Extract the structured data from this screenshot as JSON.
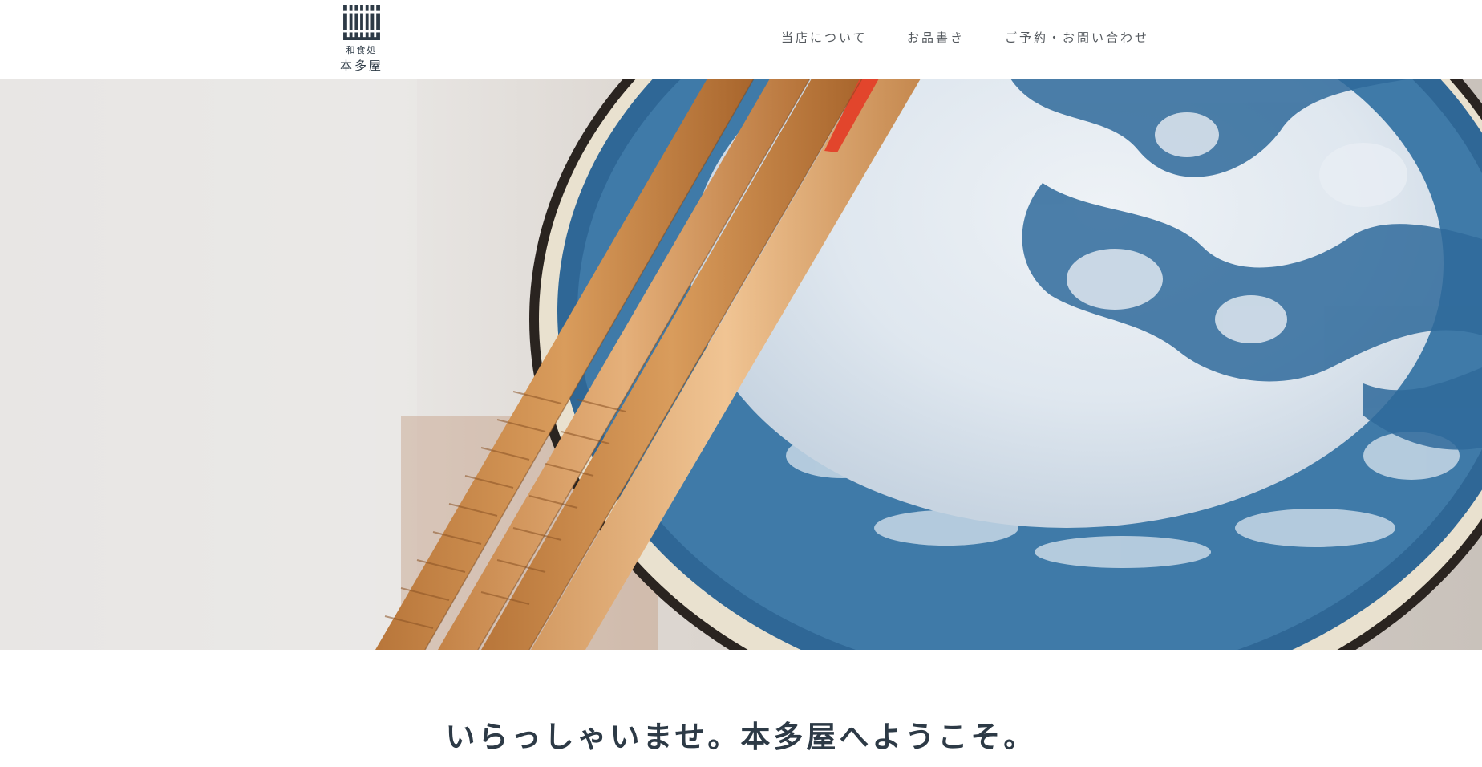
{
  "site": {
    "logo_subtitle": "和食処",
    "logo_name": "本多屋",
    "logo_icon": "lattice-gate-icon",
    "brand_color": "#2d3a46"
  },
  "nav": {
    "items": [
      {
        "label": "当店について"
      },
      {
        "label": "お品書き"
      },
      {
        "label": "ご予約・お問い合わせ"
      }
    ]
  },
  "hero": {
    "image": "chopsticks-and-blue-plate-photo"
  },
  "welcome": {
    "heading": "いらっしゃいませ。本多屋へようこそ。"
  }
}
